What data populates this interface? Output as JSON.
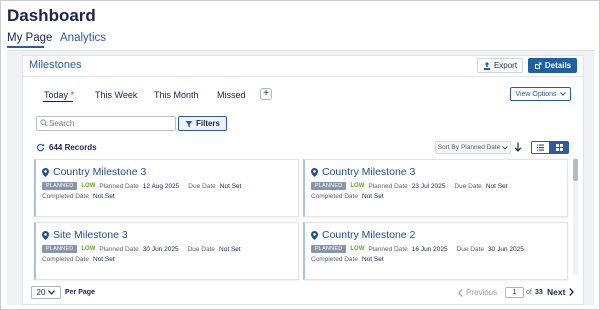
{
  "page": {
    "title": "Dashboard"
  },
  "tabs": [
    {
      "label": "My Page",
      "active": true
    },
    {
      "label": "Analytics",
      "active": false
    }
  ],
  "panel": {
    "title": "Milestones",
    "export_label": "Export",
    "details_label": "Details"
  },
  "filter_tabs": [
    {
      "label": "Today",
      "required_mark": "*",
      "active": true
    },
    {
      "label": "This Week"
    },
    {
      "label": "This Month"
    },
    {
      "label": "Missed"
    }
  ],
  "add_tab_label": "+",
  "view_options_label": "View Options",
  "search": {
    "placeholder": "Search",
    "value": ""
  },
  "filters_label": "Filters",
  "records_label": "644 Records",
  "sort": {
    "label": "Sort By",
    "value": "Planned Date"
  },
  "cards": [
    {
      "title": "Country Milestone 3",
      "status": "PLANNED",
      "priority": "LOW",
      "planned_label": "Planned Date",
      "planned_date": "12 Aug 2025",
      "due_label": "Due Date",
      "due_date": "Not Set",
      "completed_label": "Completed Date",
      "completed_date": "Not Set"
    },
    {
      "title": "Country Milestone 3",
      "status": "PLANNED",
      "priority": "LOW",
      "planned_label": "Planned Date",
      "planned_date": "23 Jul 2025",
      "due_label": "Due Date",
      "due_date": "Not Set",
      "completed_label": "Completed Date",
      "completed_date": "Not Set"
    },
    {
      "title": "Site Milestone 3",
      "status": "PLANNED",
      "priority": "LOW",
      "planned_label": "Planned Date",
      "planned_date": "30 Jun 2025",
      "due_label": "Due Date",
      "due_date": "Not Set",
      "completed_label": "Completed Date",
      "completed_date": "Not Set"
    },
    {
      "title": "Country Milestone 2",
      "status": "PLANNED",
      "priority": "LOW",
      "planned_label": "Planned Date",
      "planned_date": "16 Jun 2025",
      "due_label": "Due Date",
      "due_date": "30 Jun 2025",
      "completed_label": "Completed Date",
      "completed_date": "Not Set"
    }
  ],
  "pagination": {
    "per_page_value": "20",
    "per_page_label": "Per Page",
    "previous_label": "Previous",
    "current_page": "1",
    "of_label": "of",
    "total_pages": "33",
    "next_label": "Next"
  },
  "colors": {
    "accent": "#2a5aa8",
    "primary_button": "#1e5fa6",
    "badge": "#8795ad",
    "low": "#5ca91f"
  }
}
